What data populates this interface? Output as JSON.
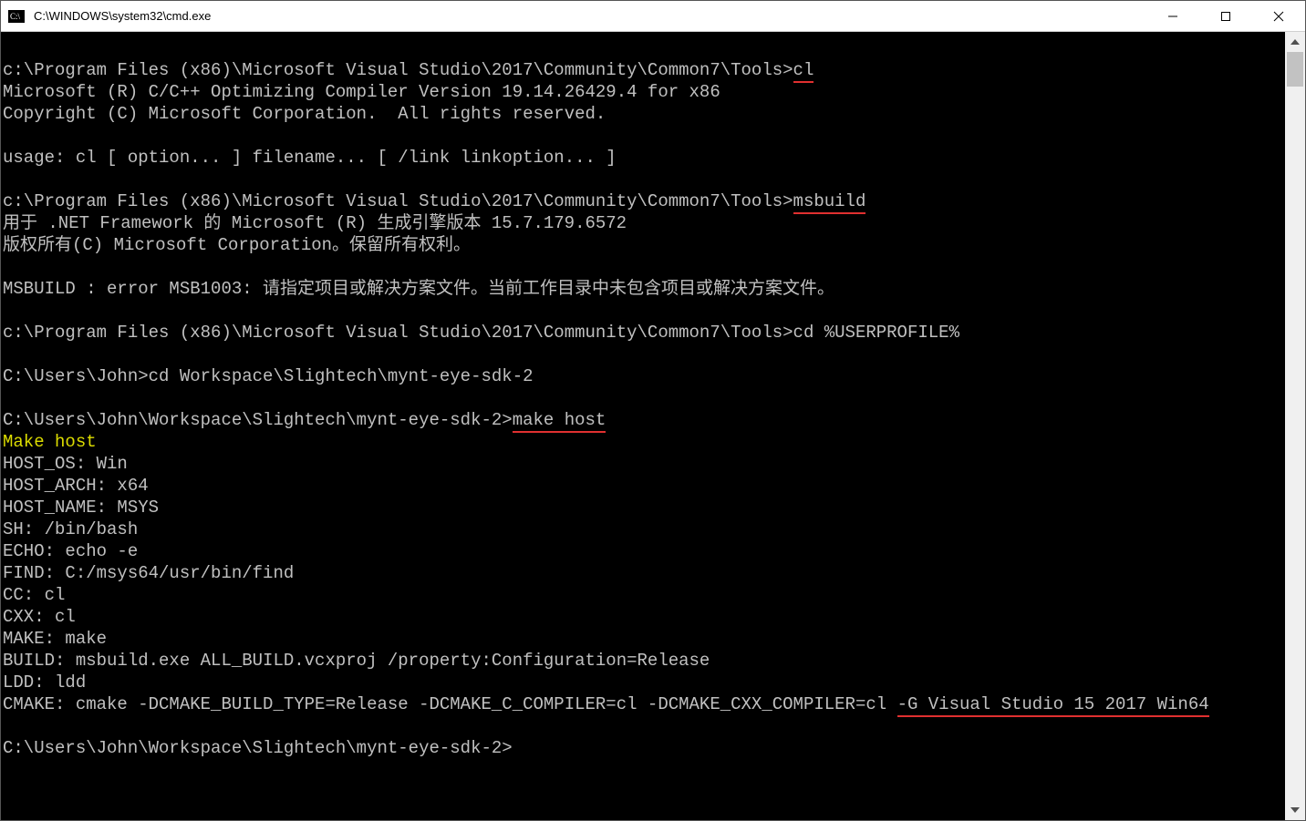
{
  "window": {
    "title": "C:\\WINDOWS\\system32\\cmd.exe"
  },
  "terminal": {
    "lines": [
      {
        "segments": [
          {
            "t": ""
          }
        ]
      },
      {
        "segments": [
          {
            "t": "c:\\Program Files (x86)\\Microsoft Visual Studio\\2017\\Community\\Common7\\Tools>"
          },
          {
            "t": "cl",
            "u": true
          }
        ]
      },
      {
        "segments": [
          {
            "t": "Microsoft (R) C/C++ Optimizing Compiler Version 19.14.26429.4 for x86"
          }
        ]
      },
      {
        "segments": [
          {
            "t": "Copyright (C) Microsoft Corporation.  All rights reserved."
          }
        ]
      },
      {
        "segments": [
          {
            "t": ""
          }
        ]
      },
      {
        "segments": [
          {
            "t": "usage: cl [ option... ] filename... [ /link linkoption... ]"
          }
        ]
      },
      {
        "segments": [
          {
            "t": ""
          }
        ]
      },
      {
        "segments": [
          {
            "t": "c:\\Program Files (x86)\\Microsoft Visual Studio\\2017\\Community\\Common7\\Tools>"
          },
          {
            "t": "msbuild",
            "u": true
          }
        ]
      },
      {
        "segments": [
          {
            "t": "用于 .NET Framework 的 Microsoft (R) 生成引擎版本 15.7.179.6572"
          }
        ]
      },
      {
        "segments": [
          {
            "t": "版权所有(C) Microsoft Corporation。保留所有权利。"
          }
        ]
      },
      {
        "segments": [
          {
            "t": ""
          }
        ]
      },
      {
        "segments": [
          {
            "t": "MSBUILD : error MSB1003: 请指定项目或解决方案文件。当前工作目录中未包含项目或解决方案文件。"
          }
        ]
      },
      {
        "segments": [
          {
            "t": ""
          }
        ]
      },
      {
        "segments": [
          {
            "t": "c:\\Program Files (x86)\\Microsoft Visual Studio\\2017\\Community\\Common7\\Tools>cd %USERPROFILE%"
          }
        ]
      },
      {
        "segments": [
          {
            "t": ""
          }
        ]
      },
      {
        "segments": [
          {
            "t": "C:\\Users\\John>cd Workspace\\Slightech\\mynt-eye-sdk-2"
          }
        ]
      },
      {
        "segments": [
          {
            "t": ""
          }
        ]
      },
      {
        "segments": [
          {
            "t": "C:\\Users\\John\\Workspace\\Slightech\\mynt-eye-sdk-2>"
          },
          {
            "t": "make host",
            "u": true
          }
        ]
      },
      {
        "segments": [
          {
            "t": "Make host",
            "c": "yellow"
          }
        ]
      },
      {
        "segments": [
          {
            "t": "HOST_OS: Win"
          }
        ]
      },
      {
        "segments": [
          {
            "t": "HOST_ARCH: x64"
          }
        ]
      },
      {
        "segments": [
          {
            "t": "HOST_NAME: MSYS"
          }
        ]
      },
      {
        "segments": [
          {
            "t": "SH: /bin/bash"
          }
        ]
      },
      {
        "segments": [
          {
            "t": "ECHO: echo -e"
          }
        ]
      },
      {
        "segments": [
          {
            "t": "FIND: C:/msys64/usr/bin/find"
          }
        ]
      },
      {
        "segments": [
          {
            "t": "CC: cl"
          }
        ]
      },
      {
        "segments": [
          {
            "t": "CXX: cl"
          }
        ]
      },
      {
        "segments": [
          {
            "t": "MAKE: make"
          }
        ]
      },
      {
        "segments": [
          {
            "t": "BUILD: msbuild.exe ALL_BUILD.vcxproj /property:Configuration=Release"
          }
        ]
      },
      {
        "segments": [
          {
            "t": "LDD: ldd"
          }
        ]
      },
      {
        "segments": [
          {
            "t": "CMAKE: cmake -DCMAKE_BUILD_TYPE=Release -DCMAKE_C_COMPILER=cl -DCMAKE_CXX_COMPILER=cl "
          },
          {
            "t": "-G Visual Studio 15 2017 Win64",
            "u": true
          }
        ]
      },
      {
        "segments": [
          {
            "t": ""
          }
        ]
      },
      {
        "segments": [
          {
            "t": "C:\\Users\\John\\Workspace\\Slightech\\mynt-eye-sdk-2>"
          }
        ]
      }
    ]
  }
}
